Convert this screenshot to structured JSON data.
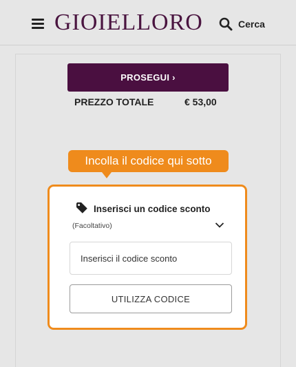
{
  "header": {
    "logo": "GIOIELLORO",
    "menu_icon": "hamburger-menu-icon",
    "search_icon": "search-icon",
    "search_label": "Cerca"
  },
  "checkout": {
    "proceed_label": "PROSEGUI ›",
    "total_label": "PREZZO TOTALE",
    "total_value": "€ 53,00"
  },
  "callout": {
    "text": "Incolla il codice qui sotto"
  },
  "coupon": {
    "tag_icon": "tag-icon",
    "title": "Inserisci un codice sconto",
    "optional_note": "(Facoltativo)",
    "toggle_icon": "chevron-down-icon",
    "input_placeholder": "Inserisci il codice sconto",
    "input_value": "",
    "apply_label": "UTILIZZA CODICE"
  },
  "colors": {
    "brand": "#4a0f40",
    "accent": "#ef8b1c",
    "background": "#e6e6e6"
  }
}
